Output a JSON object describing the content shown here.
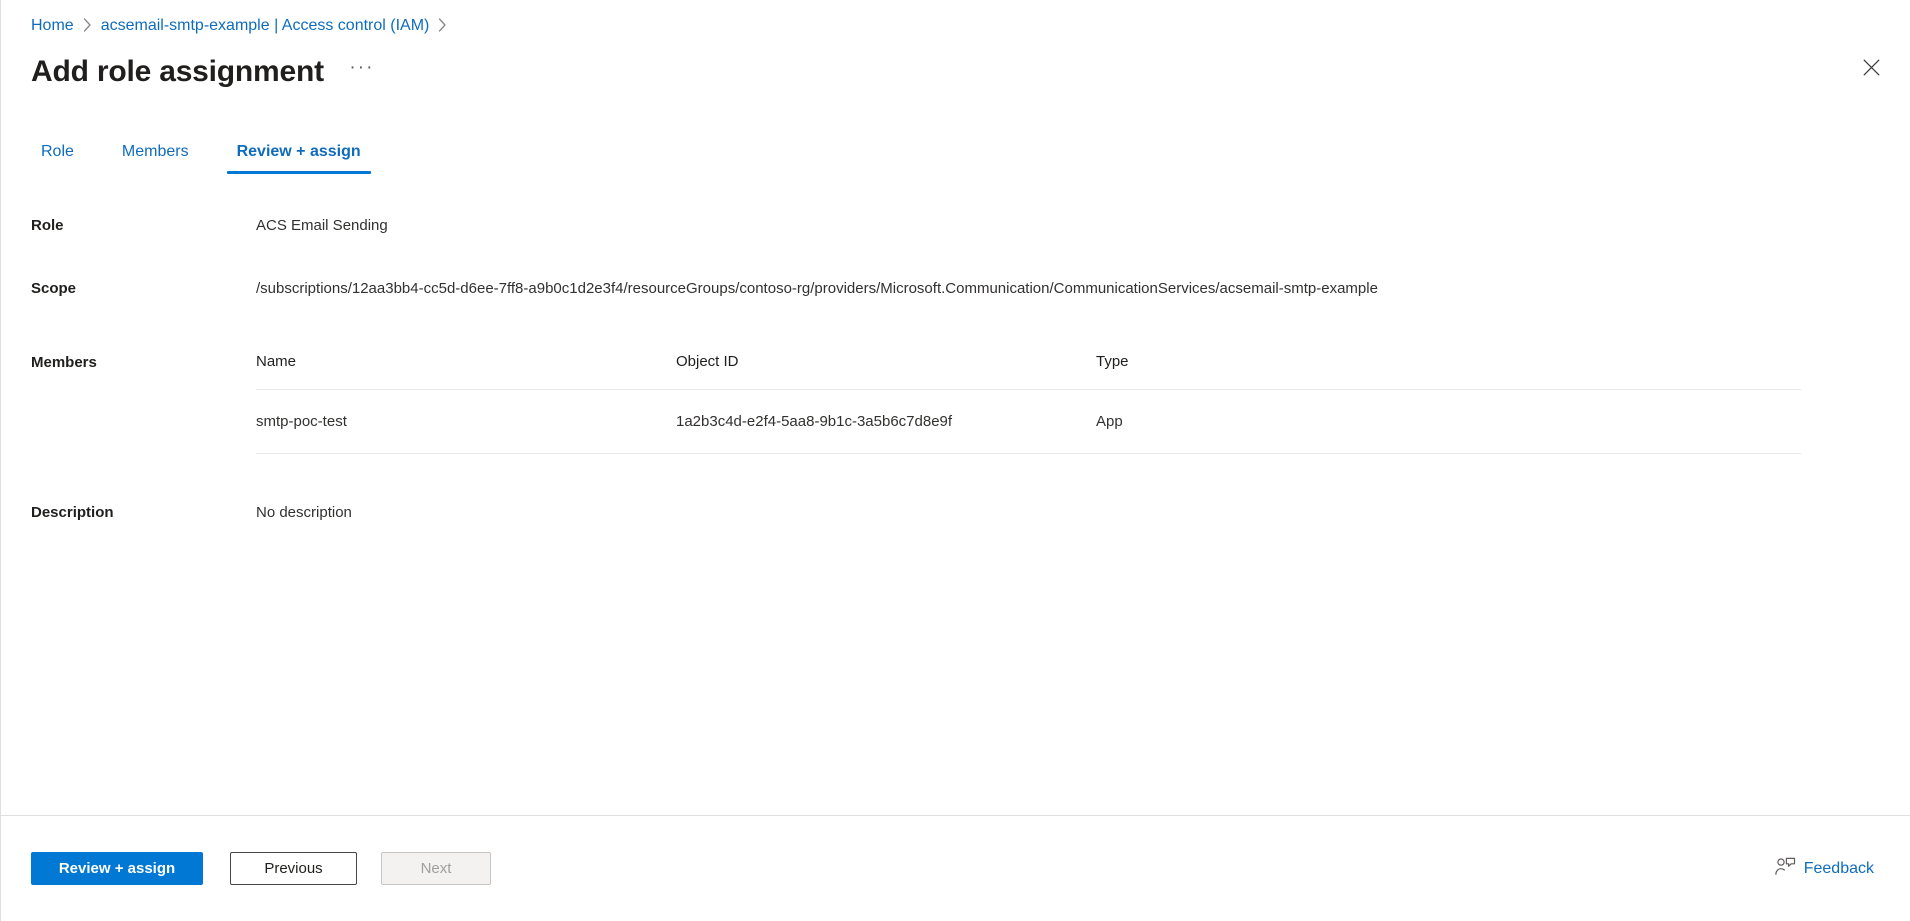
{
  "breadcrumb": {
    "items": [
      {
        "label": "Home"
      },
      {
        "label": "acsemail-smtp-example | Access control (IAM)"
      }
    ],
    "separator_icon": "chevron-right-icon"
  },
  "header": {
    "title": "Add role assignment",
    "more_menu_label": "···",
    "more_menu_icon": "ellipsis-icon",
    "close_icon": "close-icon"
  },
  "tabs": [
    {
      "label": "Role",
      "active": false
    },
    {
      "label": "Members",
      "active": false
    },
    {
      "label": "Review + assign",
      "active": true
    }
  ],
  "review": {
    "role": {
      "label": "Role",
      "value": "ACS Email Sending"
    },
    "scope": {
      "label": "Scope",
      "value": "/subscriptions/12aa3bb4-cc5d-d6ee-7ff8-a9b0c1d2e3f4/resourceGroups/contoso-rg/providers/Microsoft.Communication/CommunicationServices/acsemail-smtp-example"
    },
    "members": {
      "label": "Members",
      "columns": [
        "Name",
        "Object ID",
        "Type"
      ],
      "rows": [
        {
          "name": "smtp-poc-test",
          "object_id": "1a2b3c4d-e2f4-5aa8-9b1c-3a5b6c7d8e9f",
          "type": "App"
        }
      ]
    },
    "description": {
      "label": "Description",
      "value": "No description"
    }
  },
  "footer": {
    "primary_button": "Review + assign",
    "previous_button": "Previous",
    "next_button": "Next",
    "feedback_label": "Feedback",
    "feedback_icon": "person-feedback-icon"
  },
  "colors": {
    "accent": "#0078d4",
    "link": "#0f6cbd",
    "text": "#201f1e",
    "border": "#e1dfdd",
    "table_border": "#edebe9",
    "disabled_text": "#a19f9d"
  }
}
